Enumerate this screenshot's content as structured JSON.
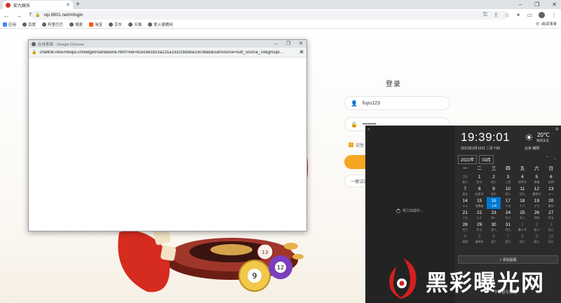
{
  "browser": {
    "tab_title": "安九娱乐",
    "new_tab": "+",
    "address": "vip.tl901.net/#/login",
    "window_controls": [
      "–",
      "❐",
      "✕"
    ]
  },
  "bookmarks": {
    "items": [
      "应用",
      "百度",
      "阿里巴巴",
      "搜索",
      "淘宝",
      "京东",
      "天猫",
      "爱火德赛网"
    ],
    "reading_list": "阅读清单"
  },
  "login": {
    "title": "登录",
    "username": "fuyu123",
    "password": "••••••••",
    "remember": "记住",
    "login_button": "",
    "demo_button": "一键试玩"
  },
  "popup": {
    "title": "在线客服 - Google Chrome",
    "url": "chatlink-new.meiqia.cn/widget/standalone.html?eid=b2eceb1b23a231a1332cbda0a15038ab&subSource=sub_source_14&groupi..."
  },
  "calendar": {
    "loading": "努力加载中...",
    "time": "19:39:01",
    "date": "2022年3月16日 二月十四",
    "temp": "20℃",
    "weather_desc": "晴转多云",
    "location": "北京 朝阳",
    "year": "2022年",
    "month": "03月",
    "weekdays": [
      "一",
      "二",
      "三",
      "四",
      "五",
      "六",
      "日"
    ],
    "add_reminder": "+ 添加提醒",
    "no_reminder": "今日暂无提醒",
    "days": [
      {
        "d": "28",
        "l": "初六",
        "m": true
      },
      {
        "d": "1",
        "l": "初七",
        "m": false
      },
      {
        "d": "2",
        "l": "初八",
        "m": false
      },
      {
        "d": "3",
        "l": "三月",
        "m": false
      },
      {
        "d": "4",
        "l": "初四节",
        "m": false
      },
      {
        "d": "5",
        "l": "惊蛰",
        "m": false
      },
      {
        "d": "6",
        "l": "初四",
        "m": false
      },
      {
        "d": "7",
        "l": "初五",
        "m": false
      },
      {
        "d": "8",
        "l": "妇女节",
        "m": false
      },
      {
        "d": "9",
        "l": "初七",
        "m": false
      },
      {
        "d": "10",
        "l": "初八",
        "m": false
      },
      {
        "d": "11",
        "l": "初九",
        "m": false
      },
      {
        "d": "12",
        "l": "植树节",
        "m": false
      },
      {
        "d": "13",
        "l": "十一",
        "m": false
      },
      {
        "d": "14",
        "l": "十二",
        "m": false
      },
      {
        "d": "15",
        "l": "消费者",
        "m": false
      },
      {
        "d": "16",
        "l": "十四",
        "m": false,
        "today": true
      },
      {
        "d": "17",
        "l": "十五",
        "m": false
      },
      {
        "d": "18",
        "l": "十六",
        "m": false
      },
      {
        "d": "19",
        "l": "十七",
        "m": false
      },
      {
        "d": "20",
        "l": "春分",
        "m": false
      },
      {
        "d": "21",
        "l": "十九",
        "m": false
      },
      {
        "d": "22",
        "l": "二十",
        "m": false
      },
      {
        "d": "23",
        "l": "廿一",
        "m": false
      },
      {
        "d": "24",
        "l": "廿二",
        "m": false
      },
      {
        "d": "25",
        "l": "廿三",
        "m": false
      },
      {
        "d": "26",
        "l": "廿四",
        "m": false
      },
      {
        "d": "27",
        "l": "廿五",
        "m": false
      },
      {
        "d": "28",
        "l": "廿六",
        "m": false
      },
      {
        "d": "29",
        "l": "廿七",
        "m": false
      },
      {
        "d": "30",
        "l": "廿八",
        "m": false
      },
      {
        "d": "31",
        "l": "廿九",
        "m": false
      },
      {
        "d": "1",
        "l": "愚人节",
        "m": true
      },
      {
        "d": "2",
        "l": "初二",
        "m": true
      },
      {
        "d": "3",
        "l": "初三",
        "m": true
      },
      {
        "d": "4",
        "l": "初四",
        "m": true
      },
      {
        "d": "5",
        "l": "清明节",
        "m": true
      },
      {
        "d": "6",
        "l": "初六",
        "m": true
      },
      {
        "d": "7",
        "l": "初七",
        "m": true
      },
      {
        "d": "8",
        "l": "初八",
        "m": true
      },
      {
        "d": "9",
        "l": "初九",
        "m": true
      },
      {
        "d": "10",
        "l": "初十",
        "m": true
      }
    ]
  },
  "watermark": {
    "text": "黑彩曝光网"
  },
  "colors": {
    "accent": "#f5a623",
    "today": "#0078d4",
    "flyout_bg": "#2b2b2b"
  }
}
